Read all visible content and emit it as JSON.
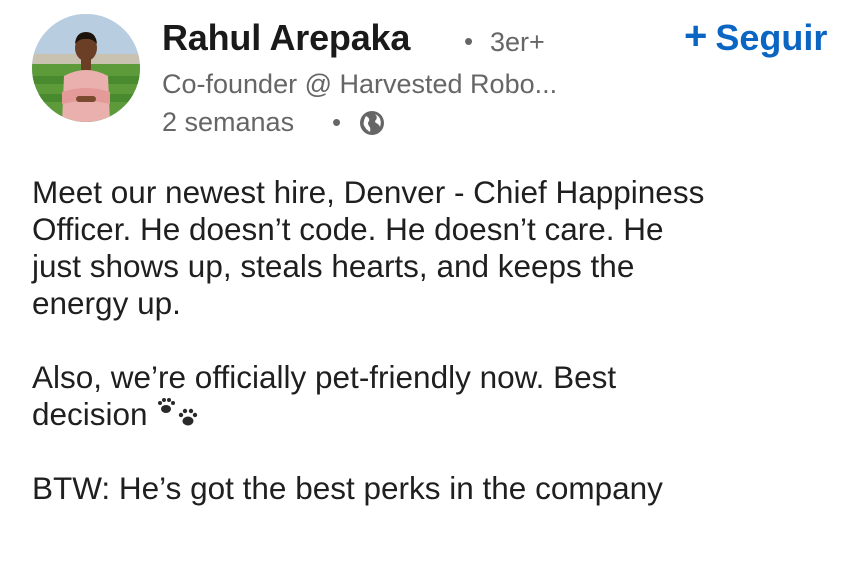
{
  "author": {
    "name": "Rahul Arepaka",
    "degree": "3er+",
    "headline": "Co-founder @ Harvested Robo...",
    "time": "2 semanas",
    "separator": "•"
  },
  "actions": {
    "follow_label": "Seguir",
    "follow_plus": "+"
  },
  "post": {
    "lines_p1": [
      "Meet our newest hire, Denver - Chief Happiness",
      "Officer. He doesn’t code. He doesn’t care. He",
      "just shows up, steals hearts, and keeps the",
      "energy up."
    ],
    "lines_p2": [
      "Also, we’re officially pet-friendly now. Best",
      "decision"
    ],
    "lines_p3": [
      "BTW: He’s got the best perks in the company"
    ]
  },
  "icons": {
    "globe": "globe-icon",
    "paw": "paw-prints-icon"
  },
  "colors": {
    "accent": "#0a66c2",
    "text": "#1f1f1f",
    "meta": "#666666"
  }
}
